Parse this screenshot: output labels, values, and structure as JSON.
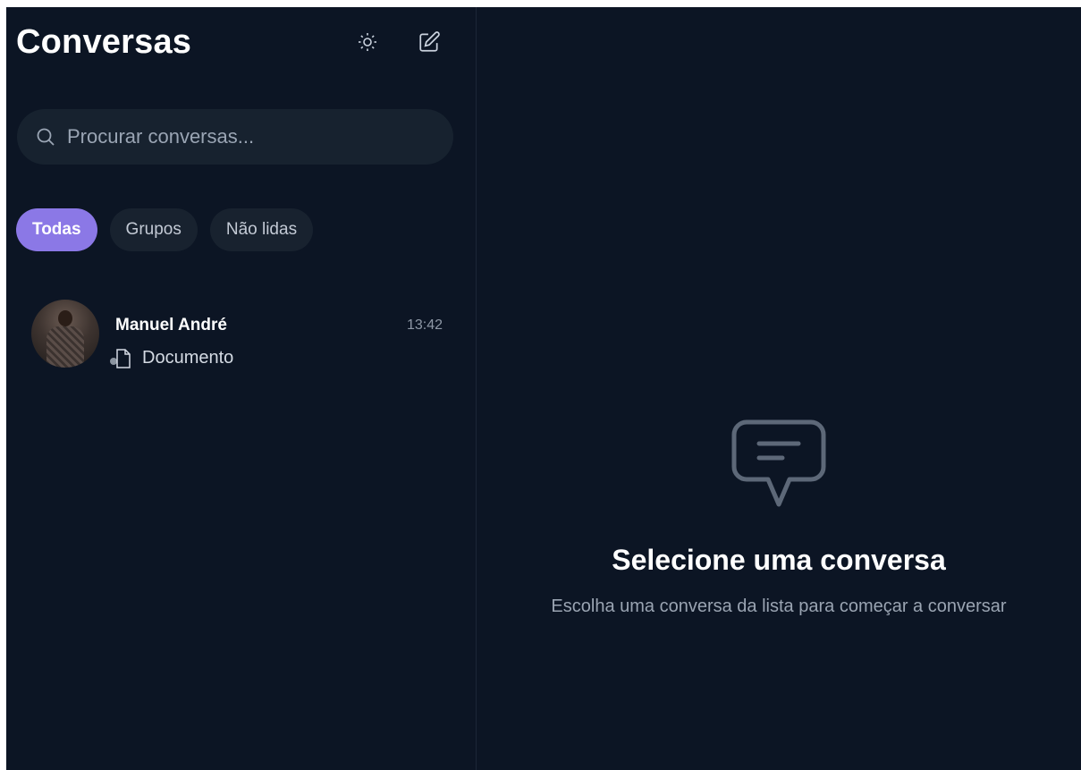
{
  "sidebar": {
    "title": "Conversas",
    "search": {
      "placeholder": "Procurar conversas..."
    },
    "filters": [
      "Todas",
      "Grupos",
      "Não lidas"
    ],
    "conversations": [
      {
        "name": "Manuel André",
        "time": "13:42",
        "preview": "Documento"
      }
    ]
  },
  "main": {
    "empty_title": "Selecione uma conversa",
    "empty_subtitle": "Escolha uma conversa da lista para começar a conversar"
  },
  "colors": {
    "background": "#0c1524",
    "accent": "#8b78e6"
  }
}
